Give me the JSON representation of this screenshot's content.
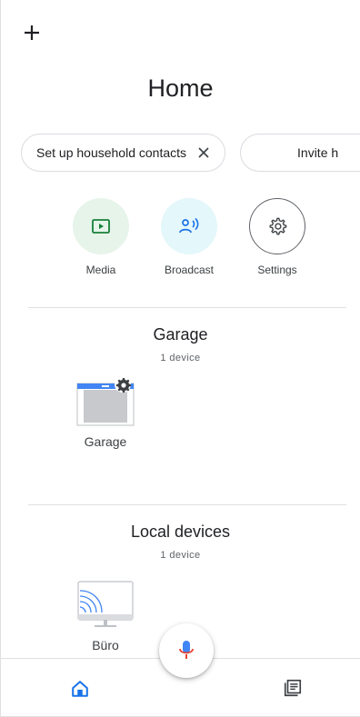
{
  "header": {
    "title": "Home",
    "add_icon": "plus-icon"
  },
  "chips": [
    {
      "label": "Set up household contacts",
      "icon": "close-icon"
    },
    {
      "label": "Invite h"
    }
  ],
  "actions": [
    {
      "label": "Media",
      "icon": "media-play-icon",
      "color": "#e6f4ea"
    },
    {
      "label": "Broadcast",
      "icon": "broadcast-icon",
      "color": "#e4f7fb"
    },
    {
      "label": "Settings",
      "icon": "gear-icon",
      "color": "#ffffff"
    }
  ],
  "sections": [
    {
      "title": "Garage",
      "count": "1 device",
      "devices": [
        {
          "label": "Garage",
          "icon": "garage-door-icon"
        }
      ]
    },
    {
      "title": "Local devices",
      "count": "1 device",
      "devices": [
        {
          "label": "Büro",
          "icon": "cast-display-icon"
        }
      ]
    }
  ],
  "bottom_nav": {
    "items": [
      {
        "name": "home",
        "icon": "home-icon",
        "active": true
      },
      {
        "name": "feed",
        "icon": "feed-icon",
        "active": false
      }
    ],
    "fab_icon": "mic-icon"
  },
  "colors": {
    "accent": "#1a73e8",
    "mic_red": "#ea4335",
    "divider": "#e0e0e0"
  }
}
